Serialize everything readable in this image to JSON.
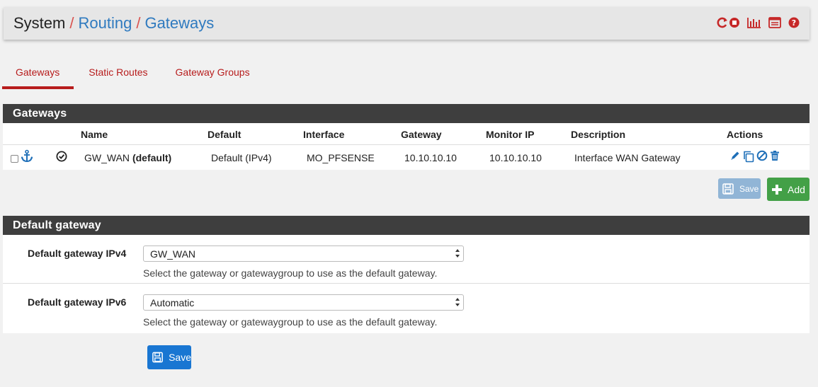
{
  "breadcrumb": {
    "part1": "System",
    "sep": "/",
    "part2": "Routing",
    "part3": "Gateways"
  },
  "header_icons": [
    "reload-icon",
    "stop-icon",
    "bar-chart-icon",
    "log-icon",
    "help-icon"
  ],
  "tabs": [
    {
      "label": "Gateways",
      "active": true
    },
    {
      "label": "Static Routes",
      "active": false
    },
    {
      "label": "Gateway Groups",
      "active": false
    }
  ],
  "gateways_panel": {
    "title": "Gateways",
    "columns": [
      "Name",
      "Default",
      "Interface",
      "Gateway",
      "Monitor IP",
      "Description",
      "Actions"
    ],
    "rows": [
      {
        "name": "GW_WAN",
        "name_suffix": "(default)",
        "default": "Default (IPv4)",
        "interface": "MO_PFSENSE",
        "gateway": "10.10.10.10",
        "monitor_ip": "10.10.10.10",
        "description": "Interface WAN Gateway"
      }
    ],
    "save_label": "Save",
    "add_label": "Add"
  },
  "default_gateway_panel": {
    "title": "Default gateway",
    "ipv4_label": "Default gateway IPv4",
    "ipv4_value": "GW_WAN",
    "ipv6_label": "Default gateway IPv6",
    "ipv6_value": "Automatic",
    "help_text": "Select the gateway or gatewaygroup to use as the default gateway.",
    "save_label": "Save"
  },
  "colors": {
    "accent_red": "#b71c1c",
    "link_blue": "#2f7abf",
    "panel_heading": "#3e3e3e",
    "save_blue": "#1976d2",
    "add_green": "#43a047"
  }
}
